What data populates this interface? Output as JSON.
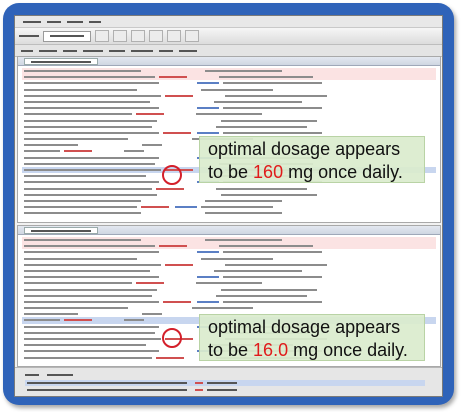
{
  "callouts": [
    {
      "prefix_line1": "optimal dosage appears",
      "prefix_line2": "to be ",
      "value": "160",
      "suffix": " mg once daily."
    },
    {
      "prefix_line1": "optimal dosage appears",
      "prefix_line2": "to be ",
      "value": "16.0",
      "suffix": " mg once daily."
    }
  ],
  "colors": {
    "frame": "#2f63b9",
    "callout_bg": "#daeccd",
    "highlight_value": "#e01b1b",
    "circle": "#d41f2a"
  }
}
